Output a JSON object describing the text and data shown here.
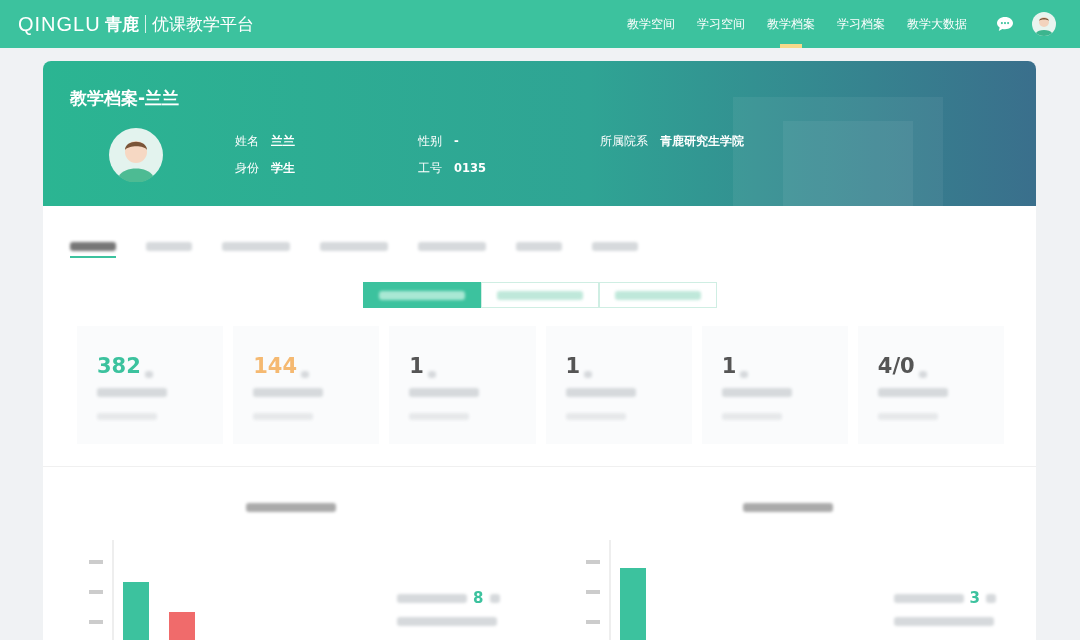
{
  "brand": {
    "logo": "QINGLU",
    "logo_cn": "青鹿",
    "product": "优课教学平台"
  },
  "nav": [
    {
      "label": "教学空间",
      "selected": false
    },
    {
      "label": "学习空间",
      "selected": false
    },
    {
      "label": "教学档案",
      "selected": true
    },
    {
      "label": "学习档案",
      "selected": false
    },
    {
      "label": "教学大数据",
      "selected": false
    }
  ],
  "banner": {
    "title": "教学档案-兰兰",
    "fields": [
      {
        "label": "姓名",
        "value": "兰兰"
      },
      {
        "label": "性别",
        "value": "-"
      },
      {
        "label": "所属院系",
        "value": "青鹿研究生学院"
      },
      {
        "label": "身份",
        "value": "学生"
      },
      {
        "label": "工号",
        "value": "0135"
      }
    ]
  },
  "tabs": [
    {
      "selected": true
    },
    {
      "selected": false
    },
    {
      "selected": false
    },
    {
      "selected": false
    },
    {
      "selected": false
    },
    {
      "selected": false
    },
    {
      "selected": false
    }
  ],
  "segments": [
    {
      "selected": true
    },
    {
      "selected": false
    },
    {
      "selected": false
    }
  ],
  "stats": [
    {
      "value": "382",
      "color": "#3cc29e"
    },
    {
      "value": "144",
      "color": "#f5b971"
    },
    {
      "value": "1",
      "color": "#555555"
    },
    {
      "value": "1",
      "color": "#555555"
    },
    {
      "value": "1",
      "color": "#555555"
    },
    {
      "value": "4/0",
      "color": "#555555"
    }
  ],
  "charts": [
    {
      "highlight": "8"
    },
    {
      "highlight": "3"
    }
  ]
}
